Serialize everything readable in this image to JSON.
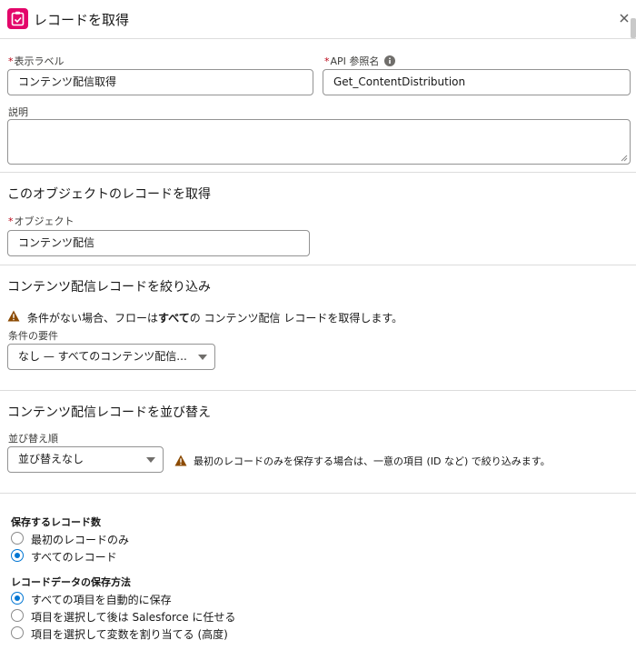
{
  "header": {
    "title": "レコードを取得",
    "icon": "get-records-icon",
    "accent": "#e3066a"
  },
  "label_field": {
    "label": "表示ラベル",
    "value": "コンテンツ配信取得"
  },
  "api_field": {
    "label": "API 参照名",
    "value": "Get_ContentDistribution"
  },
  "description_field": {
    "label": "説明",
    "value": ""
  },
  "object_section": {
    "title": "このオブジェクトのレコードを取得",
    "object_label": "オブジェクト",
    "object_value": "コンテンツ配信"
  },
  "filter_section": {
    "title": "コンテンツ配信レコードを絞り込み",
    "warning_prefix": "条件がない場合、フローは",
    "warning_bold": "すべて",
    "warning_suffix": "の コンテンツ配信 レコードを取得します。",
    "condition_label": "条件の要件",
    "condition_value": "なし — すべてのコンテンツ配信..."
  },
  "sort_section": {
    "title": "コンテンツ配信レコードを並び替え",
    "sort_label": "並び替え順",
    "sort_value": "並び替えなし",
    "warning": "最初のレコードのみを保存する場合は、一意の項目 (ID など) で絞り込みます。"
  },
  "record_count": {
    "label": "保存するレコード数",
    "options": [
      {
        "label": "最初のレコードのみ",
        "checked": false
      },
      {
        "label": "すべてのレコード",
        "checked": true
      }
    ]
  },
  "store_method": {
    "label": "レコードデータの保存方法",
    "options": [
      {
        "label": "すべての項目を自動的に保存",
        "checked": true
      },
      {
        "label": "項目を選択して後は Salesforce に任せる",
        "checked": false
      },
      {
        "label": "項目を選択して変数を割り当てる (高度)",
        "checked": false
      }
    ]
  },
  "colors": {
    "warning": "#8c4b02",
    "radio_selected": "#0176d3",
    "required": "#ba0517"
  }
}
